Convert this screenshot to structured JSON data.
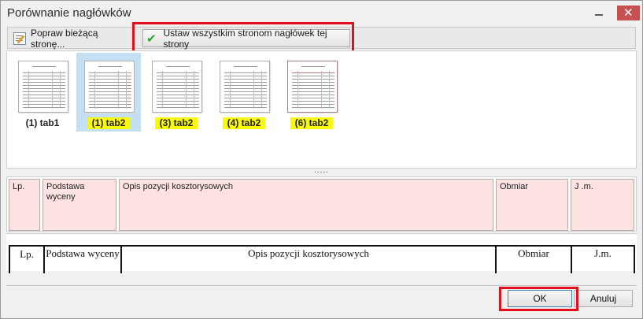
{
  "window": {
    "title": "Porównanie nagłówków"
  },
  "toolbar": {
    "fix_current": "Popraw bieżącą stronę...",
    "apply_all": "Ustaw wszystkim stronom nagłówek tej strony"
  },
  "thumbnails": [
    {
      "label": "(1) tab1",
      "selected": false,
      "highlighted": false
    },
    {
      "label": "(1) tab2",
      "selected": true,
      "highlighted": true
    },
    {
      "label": "(3) tab2",
      "selected": false,
      "highlighted": true
    },
    {
      "label": "(4) tab2",
      "selected": false,
      "highlighted": true
    },
    {
      "label": "(6) tab2",
      "selected": false,
      "highlighted": true
    }
  ],
  "splitter": ".....",
  "header_cells": [
    "Lp.",
    "Podstawa wyceny",
    "Opis pozycji kosztorysowych",
    "Obmiar",
    "J .m."
  ],
  "scan_cells": [
    "Lp.",
    "Podstawa wyceny",
    "Opis pozycji kosztorysowych",
    "Obmiar",
    "J.m."
  ],
  "buttons": {
    "ok": "OK",
    "cancel": "Anuluj"
  },
  "colors": {
    "highlight": "#f9f90c",
    "selection": "#c5dff3",
    "header_cell": "#fde2e2",
    "annotation": "#e3101b"
  }
}
